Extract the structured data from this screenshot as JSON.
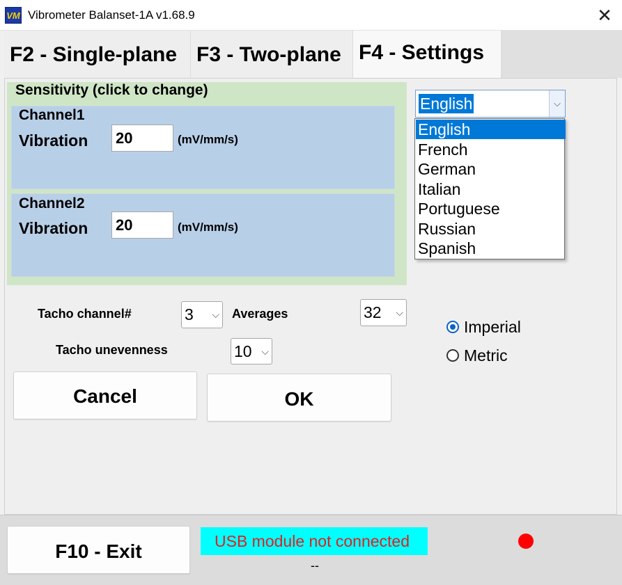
{
  "window": {
    "icon_text": "VM",
    "title": "Vibrometer Balanset-1A  v1.68.9",
    "close_glyph": "✕"
  },
  "tabs": [
    {
      "label": "F2 - Single-plane",
      "active": false
    },
    {
      "label": "F3 - Two-plane",
      "active": false
    },
    {
      "label": "F4 - Settings",
      "active": true
    }
  ],
  "sensitivity": {
    "title": "Sensitivity (click to change)",
    "channel1": {
      "title": "Channel1",
      "label": "Vibration",
      "value": "20",
      "unit": "(mV/mm/s)"
    },
    "channel2": {
      "title": "Channel2",
      "label": "Vibration",
      "value": "20",
      "unit": "(mV/mm/s)"
    }
  },
  "tacho": {
    "channel_label": "Tacho channel#",
    "channel_value": "3",
    "averages_label": "Averages",
    "averages_value": "32",
    "unevenness_label": "Tacho unevenness",
    "unevenness_value": "10"
  },
  "buttons": {
    "cancel": "Cancel",
    "ok": "OK",
    "exit": "F10 - Exit"
  },
  "language": {
    "selected": "English",
    "options": [
      "English",
      "French",
      "German",
      "Italian",
      "Portuguese",
      "Russian",
      "Spanish"
    ]
  },
  "units": {
    "imperial": "Imperial",
    "metric": "Metric",
    "selected": "Imperial"
  },
  "status": {
    "usb": "USB module not connected",
    "dash": "--",
    "indicator_color": "#ff0000"
  },
  "icons": {
    "chevron": "⌵"
  }
}
